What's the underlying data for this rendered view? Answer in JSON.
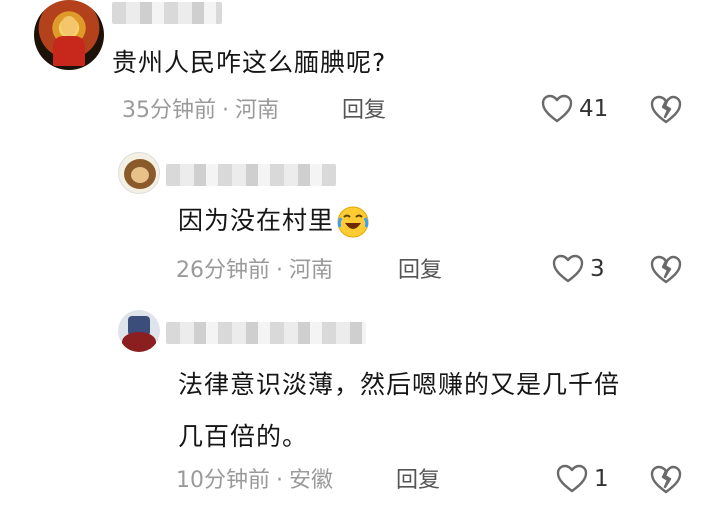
{
  "comments": [
    {
      "text": "贵州人民咋这么腼腆呢?",
      "time": "35分钟前",
      "location": "河南",
      "reply_label": "回复",
      "likes": "41"
    },
    {
      "text": "因为没在村里",
      "emoji": "laughing-crying-emoji",
      "time": "26分钟前",
      "location": "河南",
      "reply_label": "回复",
      "likes": "3"
    },
    {
      "text_line1": "法律意识淡薄，然后嗯赚的又是几千倍",
      "text_line2": "几百倍的。",
      "time": "10分钟前",
      "location": "安徽",
      "reply_label": "回复",
      "likes": "1"
    }
  ],
  "separator": "·",
  "colors": {
    "meta": "#9a9a9a",
    "text": "#161616",
    "icon": "#6a6a6a"
  }
}
